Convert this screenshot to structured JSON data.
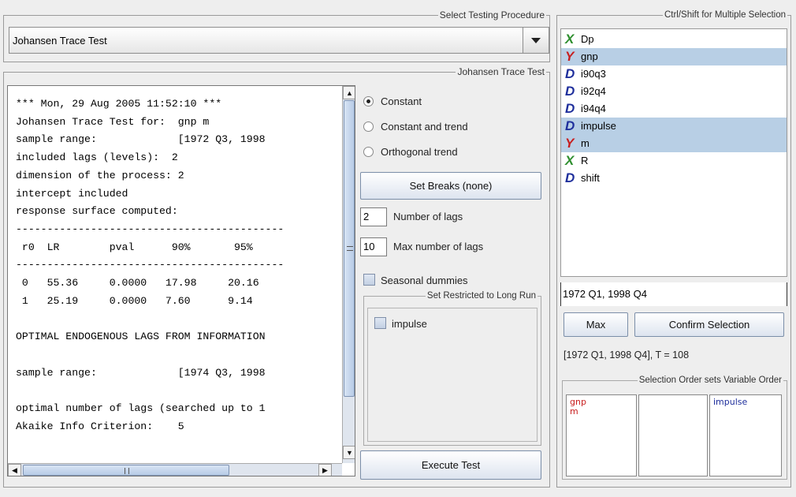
{
  "select_procedure": {
    "title": "Select Testing Procedure",
    "value": "Johansen Trace Test"
  },
  "test_panel": {
    "title": "Johansen Trace Test",
    "output_lines": [
      "*** Mon, 29 Aug 2005 11:52:10 ***",
      "Johansen Trace Test for:  gnp m",
      "sample range:             [1972 Q3, 1998",
      "included lags (levels):  2",
      "dimension of the process: 2",
      "intercept included",
      "response surface computed:",
      "-------------------------------------------",
      " r0  LR        pval      90%       95%",
      "-------------------------------------------",
      " 0   55.36     0.0000   17.98     20.16",
      " 1   25.19     0.0000   7.60      9.14",
      "",
      "OPTIMAL ENDOGENOUS LAGS FROM INFORMATION",
      "",
      "sample range:             [1974 Q3, 1998",
      "",
      "optimal number of lags (searched up to 1",
      "Akaike Info Criterion:    5"
    ],
    "options": {
      "radio": [
        {
          "label": "Constant",
          "checked": true
        },
        {
          "label": "Constant and trend",
          "checked": false
        },
        {
          "label": "Orthogonal trend",
          "checked": false
        }
      ],
      "set_breaks_label": "Set Breaks (none)",
      "lags_value": "2",
      "lags_label": "Number of lags",
      "max_lags_value": "10",
      "max_lags_label": "Max number of lags",
      "seasonal_label": "Seasonal dummies",
      "restricted_title": "Set Restricted to Long Run",
      "restricted_items": [
        {
          "label": "impulse",
          "checked": false
        }
      ],
      "execute_label": "Execute Test"
    }
  },
  "variables_panel": {
    "title": "Ctrl/Shift for Multiple Selection",
    "type_colors": {
      "X": "#2f8f2f",
      "Y": "#c81e1e",
      "D": "#1f2f9c"
    },
    "variables": [
      {
        "type": "X",
        "name": "Dp",
        "selected": false
      },
      {
        "type": "Y",
        "name": "gnp",
        "selected": true
      },
      {
        "type": "D",
        "name": "i90q3",
        "selected": false
      },
      {
        "type": "D",
        "name": "i92q4",
        "selected": false
      },
      {
        "type": "D",
        "name": "i94q4",
        "selected": false
      },
      {
        "type": "D",
        "name": "impulse",
        "selected": true
      },
      {
        "type": "Y",
        "name": "m",
        "selected": true
      },
      {
        "type": "X",
        "name": "R",
        "selected": false
      },
      {
        "type": "D",
        "name": "shift",
        "selected": false
      }
    ],
    "range_input": "1972 Q1, 1998 Q4",
    "max_label": "Max",
    "confirm_label": "Confirm Selection",
    "range_summary": "[1972 Q1, 1998 Q4], T = 108",
    "order_title": "Selection Order sets Variable Order",
    "order_columns": [
      {
        "items": [
          "gnp",
          "m"
        ],
        "color": "#c81e1e"
      },
      {
        "items": [],
        "color": "#c81e1e"
      },
      {
        "items": [
          "impulse"
        ],
        "color": "#1f2f9c"
      }
    ]
  }
}
